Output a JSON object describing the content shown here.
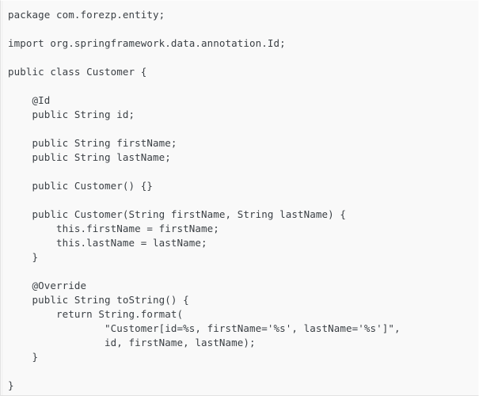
{
  "document": {
    "kind": "code-snippet",
    "language": "Java",
    "class_name": "Customer",
    "package": "com.forezp.entity",
    "background_color": "#f9f9f9",
    "text_color": "#3b4045",
    "border_color": "#e2e2e2"
  },
  "code": {
    "lines": [
      "package com.forezp.entity;",
      "",
      "import org.springframework.data.annotation.Id;",
      "",
      "public class Customer {",
      "",
      "    @Id",
      "    public String id;",
      "",
      "    public String firstName;",
      "    public String lastName;",
      "",
      "    public Customer() {}",
      "",
      "    public Customer(String firstName, String lastName) {",
      "        this.firstName = firstName;",
      "        this.lastName = lastName;",
      "    }",
      "",
      "    @Override",
      "    public String toString() {",
      "        return String.format(",
      "                \"Customer[id=%s, firstName='%s', lastName='%s']\",",
      "                id, firstName, lastName);",
      "    }",
      "",
      "}"
    ]
  }
}
